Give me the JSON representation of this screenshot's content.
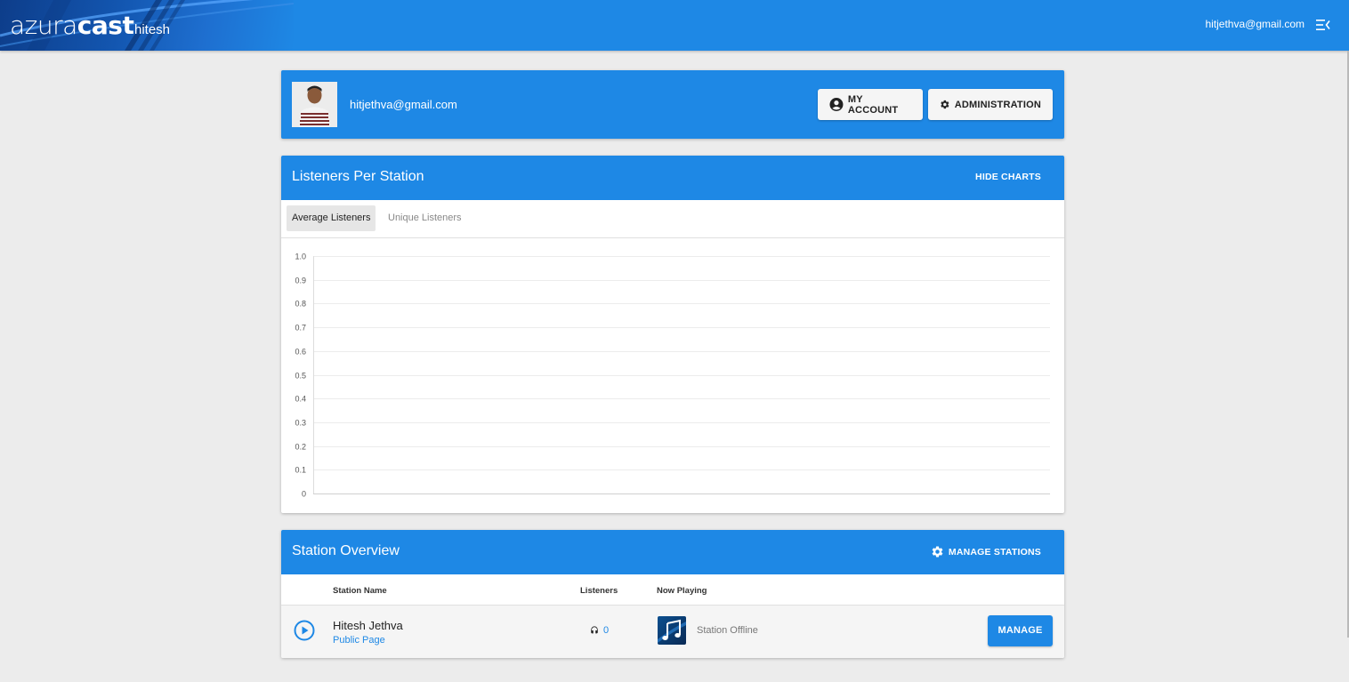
{
  "header": {
    "logo_light": "azura",
    "logo_bold": "cast",
    "instance_name": "hitesh",
    "user_email": "hitjethva@gmail.com"
  },
  "user_card": {
    "email": "hitjethva@gmail.com",
    "my_account_label": "MY ACCOUNT",
    "administration_label": "ADMINISTRATION"
  },
  "listeners_card": {
    "title": "Listeners Per Station",
    "hide_charts_label": "HIDE CHARTS",
    "tabs": [
      {
        "label": "Average Listeners",
        "active": true
      },
      {
        "label": "Unique Listeners",
        "active": false
      }
    ]
  },
  "chart_data": {
    "type": "line",
    "title": "",
    "xlabel": "",
    "ylabel": "",
    "ylim": [
      0,
      1
    ],
    "y_ticks": [
      "0",
      "0.1",
      "0.2",
      "0.3",
      "0.4",
      "0.5",
      "0.6",
      "0.7",
      "0.8",
      "0.9",
      "1.0"
    ],
    "series": [],
    "grid": true
  },
  "station_overview": {
    "title": "Station Overview",
    "manage_stations_label": "MANAGE STATIONS",
    "columns": [
      "Station Name",
      "Listeners",
      "Now Playing"
    ],
    "rows": [
      {
        "name": "Hitesh Jethva",
        "public_page": "Public Page",
        "listeners": "0",
        "now_playing": "Station Offline",
        "manage_label": "MANAGE"
      }
    ]
  },
  "colors": {
    "primary": "#1e88e5",
    "background": "#ececec"
  }
}
